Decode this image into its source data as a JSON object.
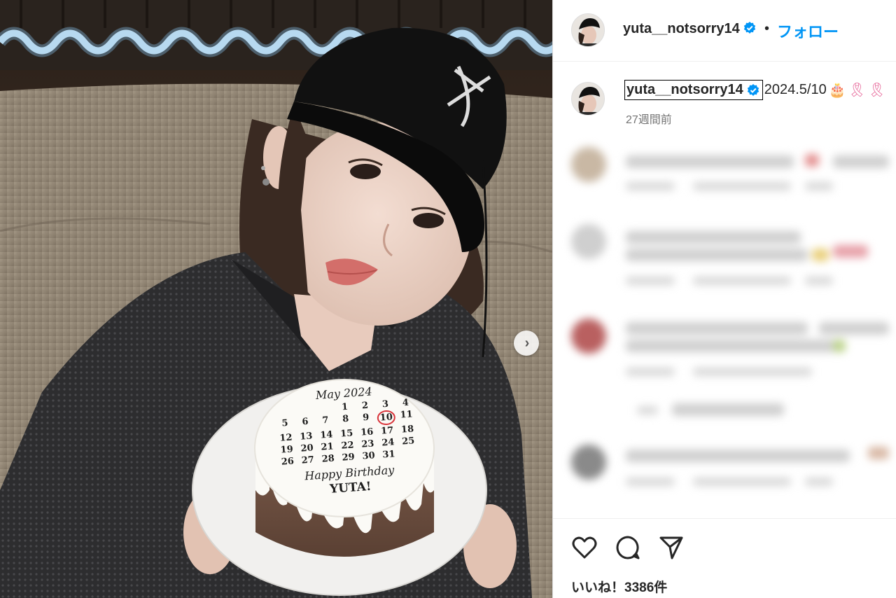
{
  "post": {
    "username": "yuta__notsorry14",
    "follow_label": "フォロー",
    "separator": "•",
    "caption_text": "2024.5/10",
    "caption_emojis": [
      "🎂",
      "🎗",
      "🎗"
    ],
    "time_ago": "27週間前",
    "likes_label": "いいね！3386件"
  },
  "photo": {
    "cake_month": "May 2024",
    "cake_dates": [
      [
        "",
        "",
        "",
        "1",
        "2",
        "3",
        "4"
      ],
      [
        "5",
        "6",
        "7",
        "8",
        "9",
        "10",
        "11"
      ],
      [
        "12",
        "13",
        "14",
        "15",
        "16",
        "17",
        "18"
      ],
      [
        "19",
        "20",
        "21",
        "22",
        "23",
        "24",
        "25"
      ],
      [
        "26",
        "27",
        "28",
        "29",
        "30",
        "31",
        ""
      ]
    ],
    "cake_message_1": "Happy Birthday",
    "cake_message_2": "YUTA!",
    "next_arrow": "›"
  },
  "icons": {
    "verified": "verified-badge-icon",
    "like": "heart-icon",
    "comment": "comment-bubble-icon",
    "share": "paper-plane-icon",
    "next": "chevron-right-icon"
  },
  "colors": {
    "follow": "#0095f6",
    "verified": "#0095f6",
    "muted": "#737373"
  }
}
